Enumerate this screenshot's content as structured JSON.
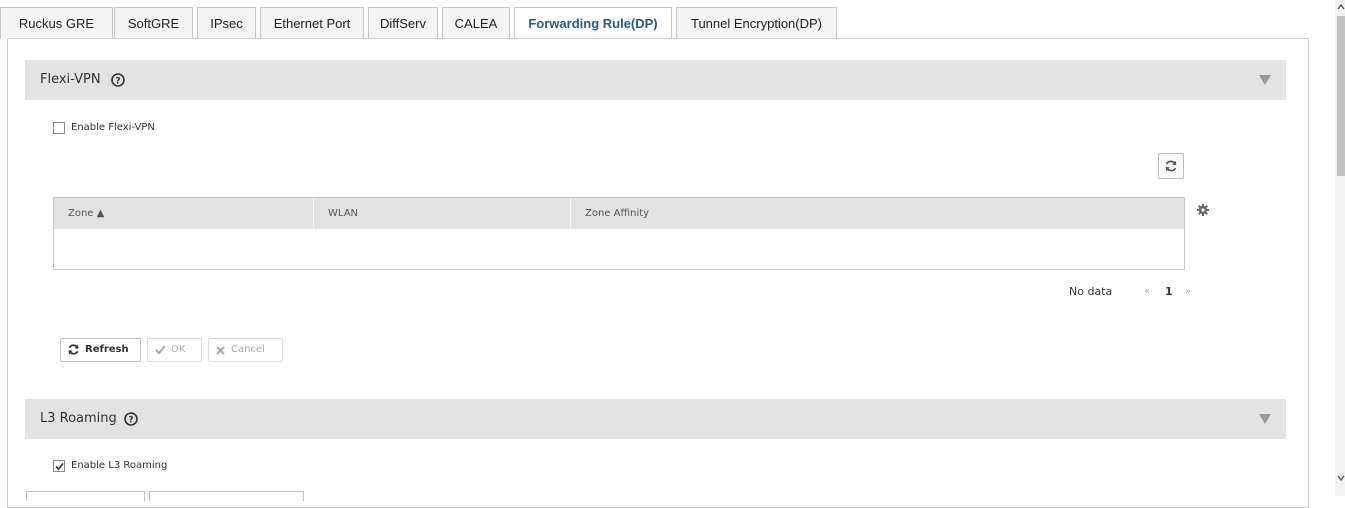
{
  "tabs": [
    {
      "label": "Ruckus GRE",
      "active": false
    },
    {
      "label": "SoftGRE",
      "active": false
    },
    {
      "label": "IPsec",
      "active": false
    },
    {
      "label": "Ethernet Port",
      "active": false
    },
    {
      "label": "DiffServ",
      "active": false
    },
    {
      "label": "CALEA",
      "active": false
    },
    {
      "label": "Forwarding Rule(DP)",
      "active": true
    },
    {
      "label": "Tunnel Encryption(DP)",
      "active": false
    }
  ],
  "flexi_vpn": {
    "title": "Flexi-VPN",
    "enable_label": "Enable Flexi-VPN",
    "enabled": false,
    "table": {
      "columns": [
        "Zone ▲",
        "WLAN",
        "Zone Affinity"
      ],
      "rows": []
    },
    "pager": {
      "status": "No data",
      "prev": "«",
      "page": "1",
      "next": "»"
    },
    "buttons": {
      "refresh": "Refresh",
      "ok": "OK",
      "cancel": "Cancel"
    }
  },
  "l3_roaming": {
    "title": "L3 Roaming",
    "enable_label": "Enable L3 Roaming",
    "enabled": true
  },
  "icons": [
    "help-icon",
    "collapse-icon",
    "refresh-icon",
    "gear-icon",
    "check-icon",
    "close-icon"
  ],
  "colors": {
    "accent": "#2a5a8a",
    "section_bg": "#e3e3e3",
    "disabled_text": "#aaaaaa"
  }
}
